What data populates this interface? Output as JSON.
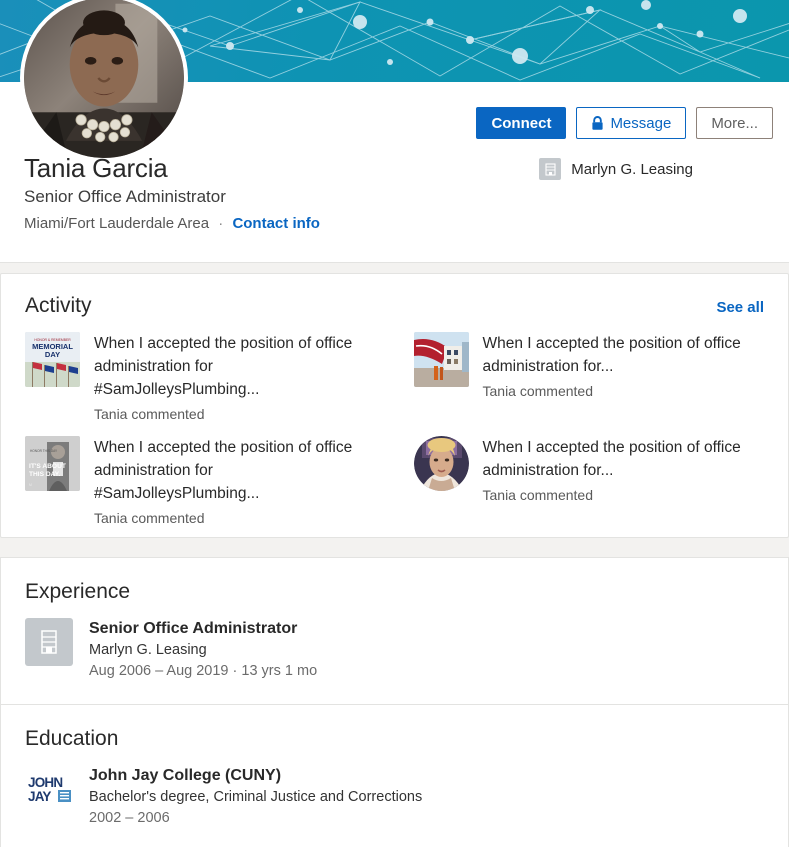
{
  "profile": {
    "name": "Tania Garcia",
    "headline": "Senior Office Administrator",
    "location": "Miami/Fort Lauderdale Area",
    "separator": "·",
    "contact_info_label": "Contact info",
    "current_company": "Marlyn G. Leasing",
    "avatar_icon": "profile-photo",
    "banner_icon": "network-pattern-banner",
    "company_logo_icon": "building-placeholder-icon"
  },
  "actions": {
    "connect_label": "Connect",
    "message_label": "Message",
    "message_icon": "lock-icon",
    "more_label": "More..."
  },
  "activity": {
    "title": "Activity",
    "see_all_label": "See all",
    "items": [
      {
        "text": "When I accepted the position of office administration for #SamJolleysPlumbing...",
        "subtitle": "Tania commented",
        "thumb_icon": "memorial-day-flags-thumbnail",
        "thumb_shape": "square"
      },
      {
        "text": "When I accepted the position of office administration for...",
        "subtitle": "Tania commented",
        "thumb_icon": "airplane-photo-thumbnail",
        "thumb_shape": "square"
      },
      {
        "text": "When I accepted the position of office administration for #SamJolleysPlumbing...",
        "subtitle": "Tania commented",
        "thumb_icon": "its-about-this-day-thumbnail",
        "thumb_shape": "square"
      },
      {
        "text": "When I accepted the position of office administration for...",
        "subtitle": "Tania commented",
        "thumb_icon": "person-avatar-thumbnail",
        "thumb_shape": "round"
      }
    ]
  },
  "experience": {
    "title": "Experience",
    "entries": [
      {
        "title": "Senior Office Administrator",
        "company": "Marlyn G. Leasing",
        "dates": "Aug 2006 – Aug 2019 · 13 yrs 1 mo",
        "logo_icon": "building-placeholder-icon"
      }
    ]
  },
  "education": {
    "title": "Education",
    "entries": [
      {
        "school": "John Jay College (CUNY)",
        "degree": "Bachelor's degree, Criminal Justice and Corrections",
        "dates": "2002 – 2006",
        "logo_icon": "john-jay-college-logo"
      }
    ]
  },
  "colors": {
    "linkedin_blue": "#0a66c2",
    "banner_teal": "#0b93b4",
    "page_bg": "#f3f2f0",
    "card_bg": "#ffffff",
    "text_primary": "#292929",
    "text_secondary": "#5a5a5a",
    "logo_placeholder_gray": "#c3c8cc",
    "john_jay_navy": "#1f3a6e"
  }
}
